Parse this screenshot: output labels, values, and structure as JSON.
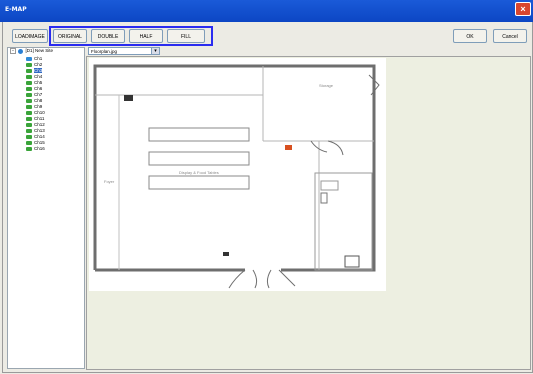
{
  "window": {
    "title": "E-MAP"
  },
  "toolbar": {
    "load_image": "LOADIMAGE",
    "original": "ORIGINAL",
    "double": "DOUBLE",
    "half": "HALF",
    "fill": "FILL",
    "ok": "OK",
    "cancel": "Cancel"
  },
  "tree": {
    "root_label": "[D1] New Site",
    "items": [
      {
        "label": "Ch1"
      },
      {
        "label": "Ch2"
      },
      {
        "label": "Ch3"
      },
      {
        "label": "Ch4"
      },
      {
        "label": "Ch5"
      },
      {
        "label": "Ch6"
      },
      {
        "label": "Ch7"
      },
      {
        "label": "Ch8"
      },
      {
        "label": "Ch9"
      },
      {
        "label": "Ch10"
      },
      {
        "label": "Ch11"
      },
      {
        "label": "Ch12"
      },
      {
        "label": "Ch13"
      },
      {
        "label": "Ch14"
      },
      {
        "label": "Ch15"
      },
      {
        "label": "Ch16"
      }
    ],
    "selected_index": 2
  },
  "image_select": {
    "value": "Floorplan.jpg"
  },
  "floorplan": {
    "labels": {
      "storage": "Storage",
      "display": "Display & Food Tables",
      "foyer": "Foyer"
    }
  },
  "colors": {
    "titlebar": "#0c46c4",
    "highlight": "#2a2cf0",
    "selection": "#316ac5"
  }
}
